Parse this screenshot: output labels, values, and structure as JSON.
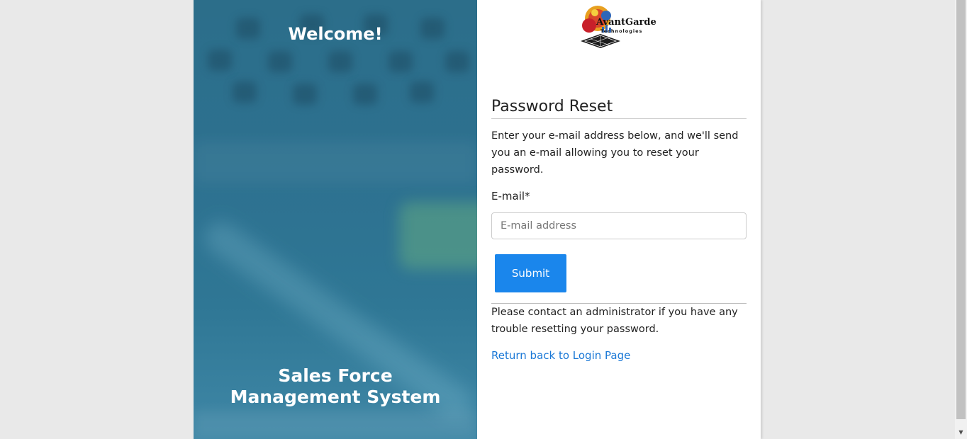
{
  "hero": {
    "title": "Welcome!",
    "subtitle": "Sales Force Management System"
  },
  "logo": {
    "name": "AvantGarde",
    "tagline": "Technologies"
  },
  "form": {
    "title": "Password Reset",
    "instructions": "Enter your e-mail address below, and we'll send you an e-mail allowing you to reset your password.",
    "email_label": "E-mail*",
    "email_placeholder": "E-mail address",
    "email_value": "",
    "submit_label": "Submit",
    "contact_note": "Please contact an administrator if you have any trouble resetting your password.",
    "return_link": "Return back to Login Page"
  },
  "colors": {
    "hero_bg": "#2d7190",
    "submit_bg": "#1a86ec",
    "link": "#1a78d6"
  }
}
